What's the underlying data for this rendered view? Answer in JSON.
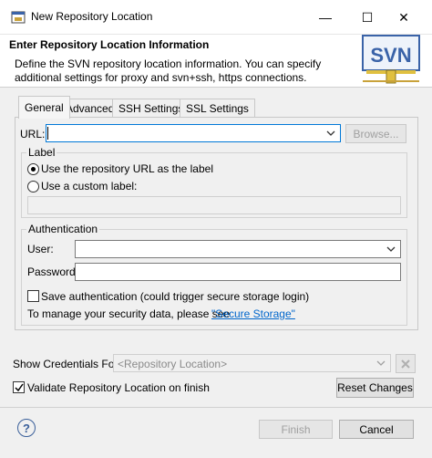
{
  "window": {
    "title": "New Repository Location",
    "minimize": "—",
    "maximize": "☐",
    "close": "✕"
  },
  "header": {
    "title": "Enter Repository Location Information",
    "description": "Define the SVN repository location information. You can specify additional settings for proxy and svn+ssh, https connections.",
    "badge_text": "SVN"
  },
  "tabs": [
    {
      "label": "General",
      "active": true
    },
    {
      "label": "Advanced"
    },
    {
      "label": "SSH Settings"
    },
    {
      "label": "SSL Settings"
    }
  ],
  "general": {
    "url_label": "URL:",
    "url_value": "",
    "browse_button": "Browse...",
    "label_group": {
      "title": "Label",
      "option_repo_url": "Use the repository URL as the label",
      "option_custom": "Use a custom label:",
      "custom_value": ""
    },
    "auth_group": {
      "title": "Authentication",
      "user_label": "User:",
      "user_value": "",
      "password_label": "Password:",
      "password_value": "",
      "save_auth_label": "Save authentication (could trigger secure storage login)",
      "security_text": "To manage your security data, please see",
      "secure_storage_link": "\"Secure Storage\""
    }
  },
  "credentials": {
    "label": "Show Credentials For:",
    "selected": "<Repository Location>"
  },
  "validate_label": "Validate Repository Location on finish",
  "reset_button": "Reset Changes",
  "footer": {
    "help": "?",
    "finish": "Finish",
    "cancel": "Cancel"
  }
}
